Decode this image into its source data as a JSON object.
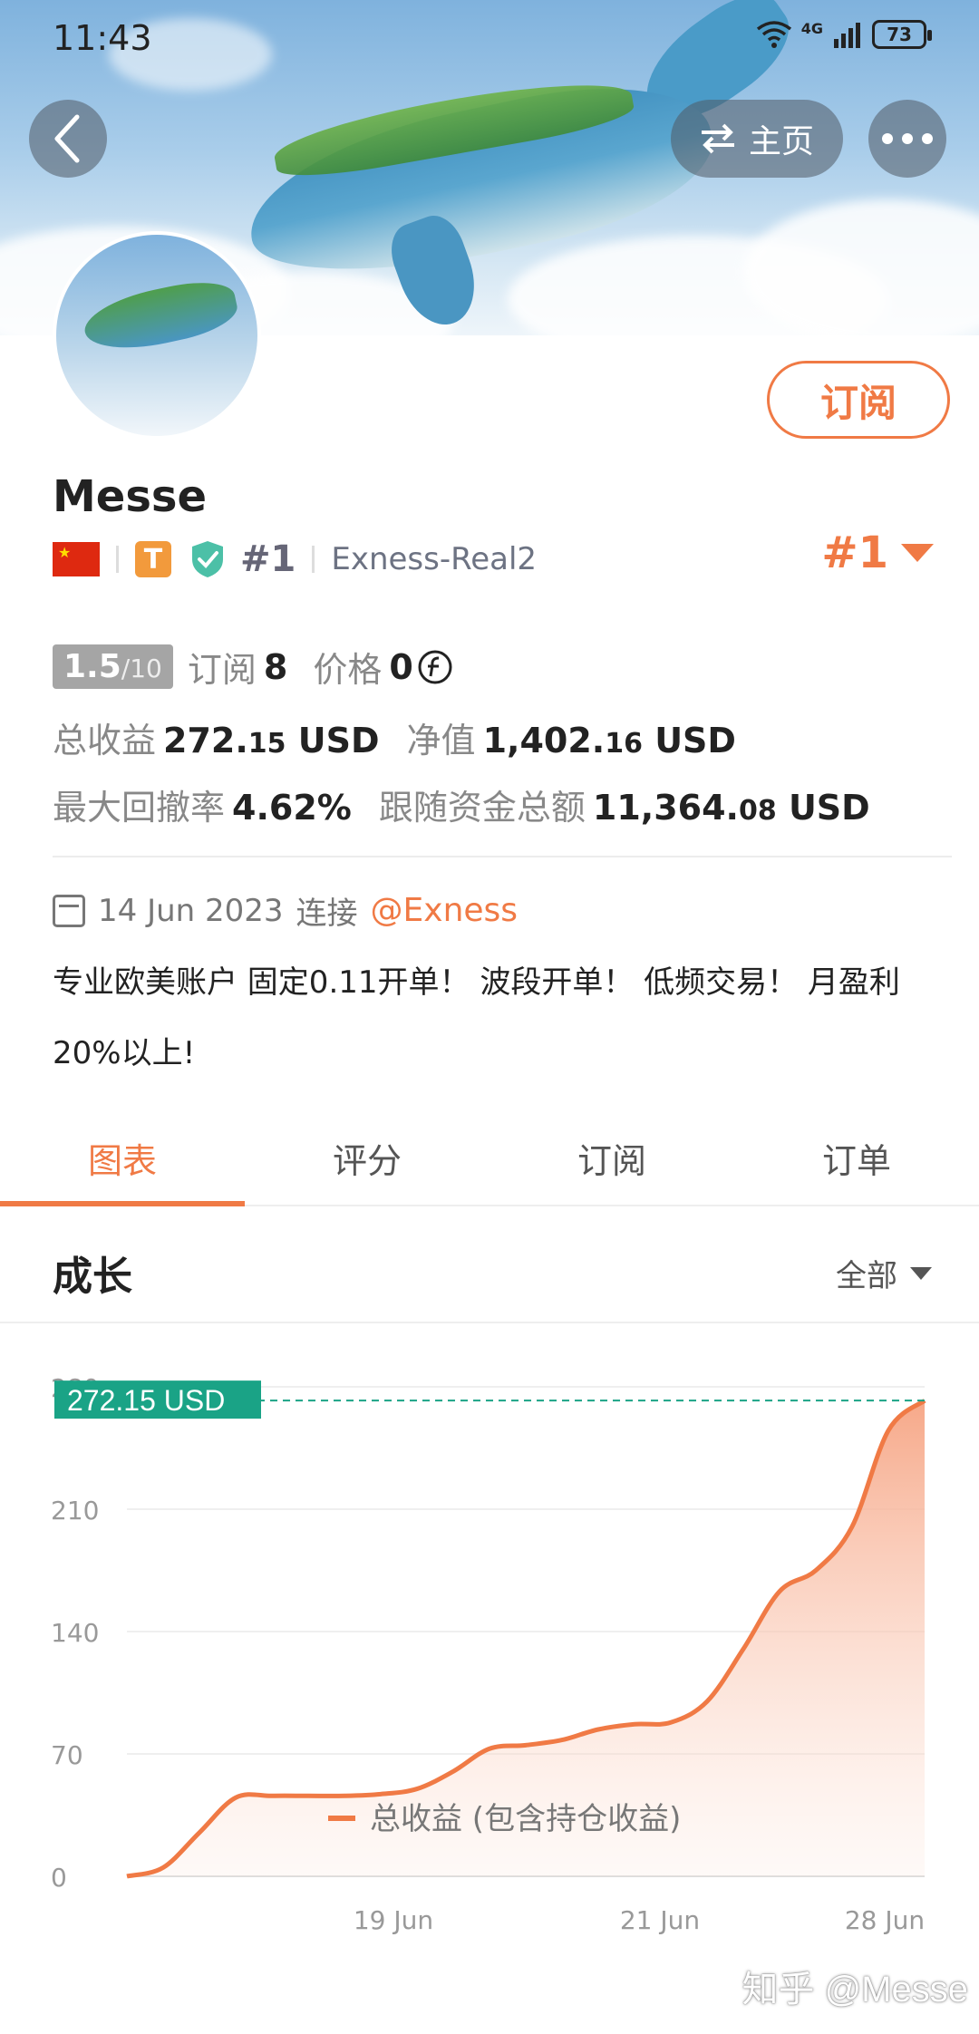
{
  "status": {
    "time": "11:43",
    "network": "4G",
    "battery": "73"
  },
  "header": {
    "home_label": "主页",
    "more_label": "•••",
    "back_label": "‹"
  },
  "profile": {
    "name": "Messe",
    "subscribe_label": "订阅",
    "tier_badge": "T",
    "rank_small": "#1",
    "server": "Exness-Real2",
    "rank_big": "#1"
  },
  "stats": {
    "score": "1.5",
    "score_max": "/10",
    "subscribers_label": "订阅",
    "subscribers": "8",
    "price_label": "价格",
    "price": "0",
    "total_profit_label": "总收益",
    "total_profit_int": "272.",
    "total_profit_dec": "15",
    "total_profit_unit": "USD",
    "equity_label": "净值",
    "equity_int": "1,402.",
    "equity_dec": "16",
    "equity_unit": "USD",
    "drawdown_label": "最大回撤率",
    "drawdown": "4.62%",
    "follow_label": "跟随资金总额",
    "follow_int": "11,364.",
    "follow_dec": "08",
    "follow_unit": "USD"
  },
  "connect": {
    "date": "14 Jun 2023",
    "text": "连接",
    "broker": "@Exness"
  },
  "description": "专业欧美账户 固定0.11开单！ 波段开单！ 低频交易！ 月盈利20%以上!",
  "tabs": [
    "图表",
    "评分",
    "订阅",
    "订单"
  ],
  "section": {
    "title": "成长",
    "range": "全部"
  },
  "chart_data": {
    "type": "area",
    "y_ticks": [
      "0",
      "70",
      "140",
      "210",
      "280"
    ],
    "x_ticks": [
      "19 Jun",
      "21 Jun",
      "28 Jun"
    ],
    "ylim": [
      0,
      280
    ],
    "current_label": "272.15 USD",
    "current_value": 272.15,
    "series": [
      {
        "name": "总收益 (包含持仓收益)",
        "values": [
          0,
          5,
          25,
          45,
          46,
          46,
          46,
          47,
          50,
          60,
          73,
          75,
          78,
          84,
          87,
          88,
          100,
          130,
          163,
          175,
          200,
          255,
          272.15
        ]
      }
    ],
    "colors": {
      "line": "#f07a45",
      "marker": "#1aa386"
    }
  },
  "watermark": "知乎 @Messe"
}
